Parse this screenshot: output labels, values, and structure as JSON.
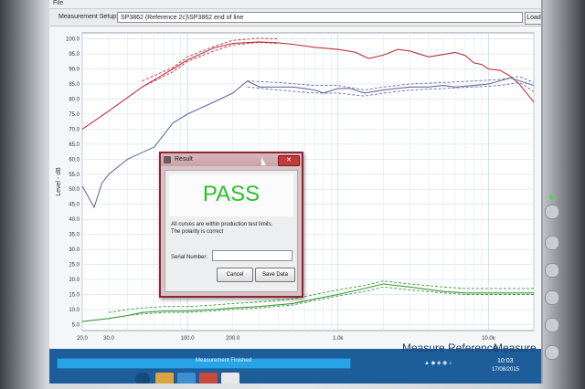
{
  "menubar": {
    "file": "File"
  },
  "setup": {
    "label": "Measurement Setup:",
    "value": "SP3862 (Reference 2c)\\SP3862 end of line",
    "load_label": "Load"
  },
  "chart_data": {
    "type": "line",
    "ylabel": "Level - dB",
    "y_ticks": [
      "100.0",
      "95.0",
      "90.0",
      "85.0",
      "80.0",
      "75.0",
      "70.0",
      "65.0",
      "60.0",
      "55.0",
      "50.0",
      "45.0",
      "40.0",
      "35.0",
      "30.0",
      "25.0",
      "20.0",
      "15.0",
      "10.0",
      "5.0"
    ],
    "x_ticks": [
      "20.0",
      "30.0",
      "100.0",
      "200.0",
      "1.0k",
      "10.0k"
    ],
    "ylim": [
      3,
      102
    ],
    "xlim": [
      20,
      20000
    ],
    "xscale": "log",
    "grid": true,
    "series": [
      {
        "color": "#c0303c",
        "x": [
          20,
          30,
          50,
          80,
          100,
          150,
          200,
          300,
          400,
          500,
          700,
          1000,
          1300,
          1600,
          2000,
          2500,
          3000,
          4000,
          5000,
          6000,
          7000,
          8000,
          9000,
          10000,
          12000,
          14000,
          16000,
          20000
        ],
        "values": [
          70,
          76,
          84,
          90,
          93,
          97,
          98.5,
          99,
          98.7,
          98.2,
          97.2,
          96.5,
          95.6,
          93.5,
          94.6,
          96.5,
          96,
          94,
          94.8,
          95.5,
          94.5,
          92,
          91.5,
          90,
          89.5,
          87.5,
          85,
          79
        ]
      },
      {
        "color": "#c0303c",
        "dashed": true,
        "x": [
          50,
          80,
          100,
          150,
          200,
          300,
          400
        ],
        "values": [
          86,
          90.5,
          94,
          97.5,
          99.5,
          100.2,
          100
        ]
      },
      {
        "color": "#c0303c",
        "dashed": true,
        "x": [
          50,
          80,
          100,
          150,
          200,
          300,
          400
        ],
        "values": [
          84,
          89,
          92.5,
          96,
          98,
          98.8,
          98.5
        ]
      },
      {
        "color": "#6a6a9e",
        "x": [
          20,
          24,
          27,
          30,
          40,
          60,
          80,
          100,
          150,
          200,
          250,
          300,
          400,
          500,
          600,
          700,
          800,
          1000,
          1200,
          1500,
          2000,
          3000,
          4000,
          5000,
          6000,
          8000,
          10000,
          14000,
          20000
        ],
        "values": [
          51,
          44,
          52,
          55,
          60,
          64,
          72,
          75,
          79,
          82,
          86,
          84,
          84,
          84,
          83.5,
          83,
          82,
          83.5,
          83.5,
          82,
          83,
          84,
          84,
          84.5,
          84,
          84.5,
          85,
          87,
          84.5
        ]
      },
      {
        "color": "#6a6a9e",
        "dashed": true,
        "x": [
          250,
          400,
          700,
          1000,
          1500,
          2000,
          3000,
          5000,
          8000,
          12000,
          16000,
          20000
        ],
        "values": [
          86,
          85.5,
          84.5,
          84.5,
          83,
          84,
          85,
          85.5,
          86,
          86.5,
          87.5,
          85.5
        ]
      },
      {
        "color": "#6a6a9e",
        "dashed": true,
        "x": [
          250,
          400,
          700,
          1000,
          1500,
          2000,
          3000,
          5000,
          8000,
          12000,
          16000,
          20000
        ],
        "values": [
          84,
          83,
          82,
          82,
          81,
          82,
          83,
          83.5,
          84,
          84.5,
          85.5,
          82.5
        ]
      },
      {
        "color": "#3c9a3c",
        "x": [
          20,
          30,
          40,
          50,
          70,
          100,
          150,
          200,
          300,
          500,
          700,
          1000,
          1500,
          2000,
          3000,
          5000,
          7000,
          10000,
          14000,
          20000
        ],
        "values": [
          6,
          7,
          8,
          9,
          9.5,
          9.5,
          10,
          10.5,
          11,
          12,
          13.5,
          15,
          17,
          18.5,
          17.5,
          16,
          15.5,
          15.5,
          15.5,
          15.5
        ]
      },
      {
        "color": "#3c9a3c",
        "dashed": true,
        "x": [
          30,
          40,
          50,
          70,
          100,
          150,
          200,
          300,
          500,
          700,
          1000,
          1500,
          2000,
          3000,
          5000,
          7000,
          10000,
          14000,
          20000
        ],
        "values": [
          9,
          10,
          10.5,
          11,
          11,
          11.5,
          12,
          12.5,
          13.5,
          15,
          16.5,
          18,
          19.5,
          18.5,
          17.5,
          17,
          17,
          17,
          17
        ]
      },
      {
        "color": "#3c9a3c",
        "dashed": true,
        "x": [
          30,
          40,
          50,
          70,
          100,
          150,
          200,
          300,
          500,
          700,
          1000,
          1500,
          2000,
          3000,
          5000,
          7000,
          10000,
          14000,
          20000
        ],
        "values": [
          7,
          8,
          8.5,
          9,
          9,
          9.5,
          10,
          10.5,
          11.5,
          13,
          14.5,
          16,
          17.5,
          16.5,
          15.5,
          15,
          15,
          15,
          15
        ]
      }
    ]
  },
  "measure_reference": {
    "primary": "Measure Reference",
    "secondary": "Measure"
  },
  "status": {
    "text": "Measurement Finished"
  },
  "clock": {
    "time": "10:03",
    "date": "17/08/2015"
  },
  "dialog": {
    "title": "Result",
    "close": "✕",
    "verdict": "PASS",
    "verdict_color": "#2cc12c",
    "message_line1": "All curves are within production test limits.",
    "message_line2": "The polarity is correct",
    "serial_label": "Serial Number:",
    "serial_value": "",
    "cancel_label": "Cancel",
    "save_label": "Save Data"
  },
  "icons": {
    "start": "windows-start-icon",
    "tray": "system-tray-icons"
  }
}
